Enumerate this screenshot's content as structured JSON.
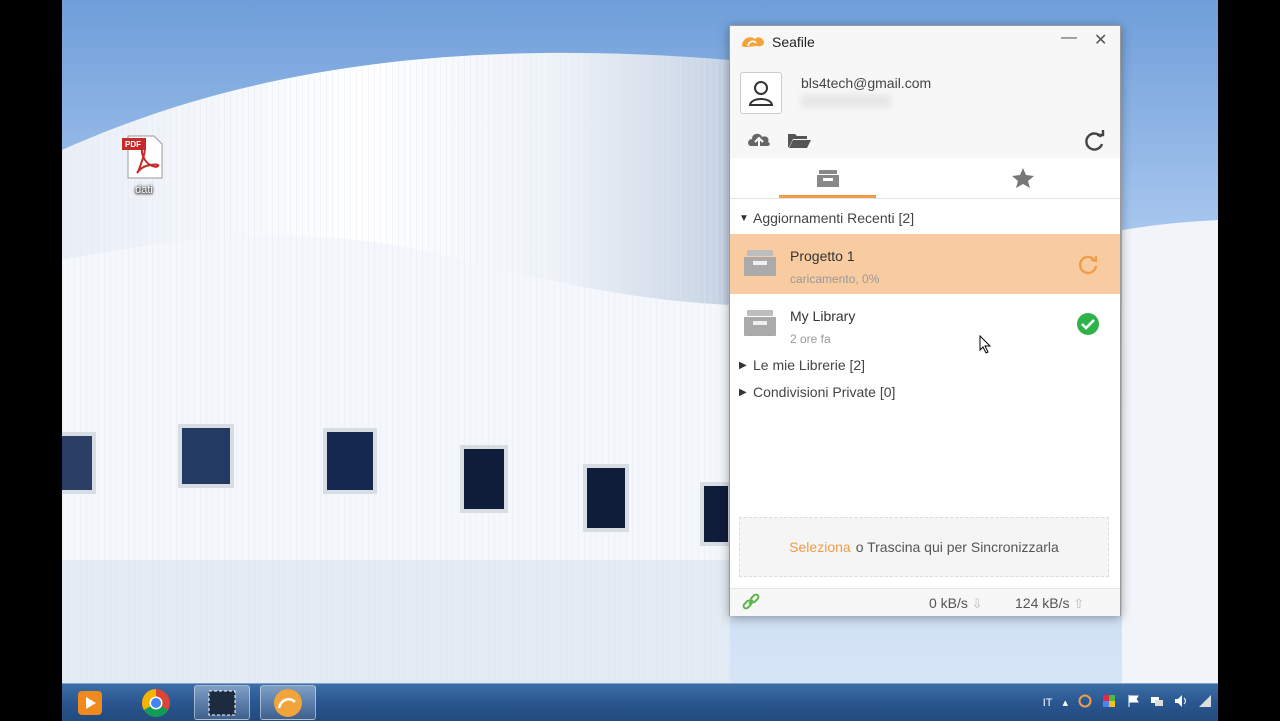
{
  "desktop": {
    "icons": [
      {
        "badge": "PDF",
        "label": "dati"
      }
    ]
  },
  "window": {
    "title": "Seafile",
    "minimize_label": "—",
    "close_label": "✕",
    "account": {
      "email": "bls4tech@gmail.com"
    },
    "tabs": [
      {
        "name": "repos",
        "icon": "repo-stack-icon",
        "active": true
      },
      {
        "name": "starred",
        "icon": "star-icon",
        "active": false
      }
    ],
    "sections": {
      "recent": {
        "label": "Aggiornamenti Recenti [2]",
        "expanded": true
      },
      "my_libraries": {
        "label": "Le mie Librerie [2]",
        "expanded": false
      },
      "private_shares": {
        "label": "Condivisioni Private [0]",
        "expanded": false
      }
    },
    "repos": [
      {
        "name": "Progetto 1",
        "status_text": "caricamento, 0%",
        "status_icon": "syncing-icon",
        "selected": true
      },
      {
        "name": "My Library",
        "status_text": "2 ore fa",
        "status_icon": "synced-check-icon",
        "selected": false
      }
    ],
    "dropzone": {
      "link_text": "Seleziona",
      "rest_text": "o Trascina qui per Sincronizzarla"
    },
    "status": {
      "download_rate": "0 kB/s",
      "upload_rate": "124 kB/s"
    }
  },
  "taskbar": {
    "language": "IT",
    "buttons": [
      "media-player-icon",
      "chrome-icon",
      "snipping-tool-icon",
      "seafile-icon"
    ]
  },
  "colors": {
    "accent": "#f09c48",
    "selected_row": "#f8cba1",
    "synced_green": "#2eb34a"
  }
}
